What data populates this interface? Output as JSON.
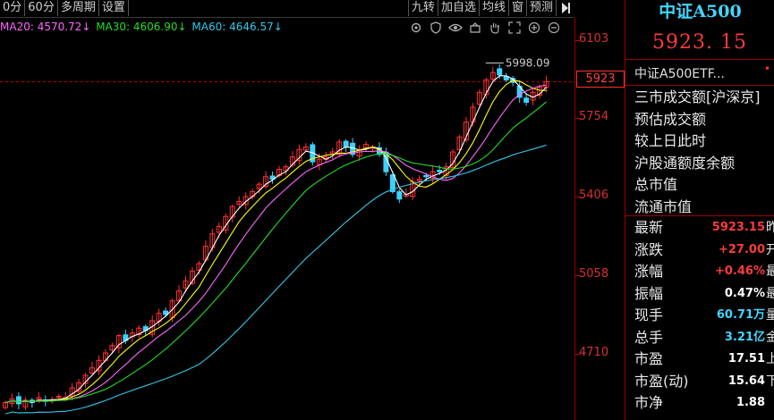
{
  "toolbar": {
    "left": [
      "0分",
      "60分",
      "多周期",
      "设置"
    ],
    "right": [
      "九转",
      "加自选",
      "均线",
      "窗",
      "预测"
    ]
  },
  "ma": {
    "ma20": "MA20: 4570.72↓",
    "ma30": "MA30: 4606.90↓",
    "ma60": "MA60: 4646.57↓",
    "colors": {
      "ma20": "#ff66ff",
      "ma30": "#22dd22",
      "ma60": "#33c8e8"
    }
  },
  "chart_icons": [
    "settings-icon",
    "shield-icon",
    "eye-icon",
    "basket-icon",
    "hand-icon",
    "expand-icon",
    "zoom-in-icon",
    "zoom-out-icon"
  ],
  "chart_data": {
    "type": "candlestick",
    "ylim": [
      4560,
      6180
    ],
    "y_ticks": [
      "6103",
      "5754",
      "5406",
      "5058",
      "4710"
    ],
    "current_price_label": "5923",
    "high_label": "5998.09",
    "series_colors": {
      "up": "#ff3232",
      "down": "#3cd2ff",
      "ma5": "#ffffff",
      "ma10": "#ffff00",
      "ma20": "#ff66ff",
      "ma30": "#22dd22",
      "ma60": "#33c8e8"
    },
    "closes": [
      4630,
      4645,
      4625,
      4640,
      4630,
      4650,
      4635,
      4640,
      4655,
      4650,
      4690,
      4710,
      4740,
      4770,
      4800,
      4830,
      4860,
      4900,
      4880,
      4910,
      4930,
      4920,
      4960,
      4990,
      4985,
      5040,
      5080,
      5120,
      5160,
      5190,
      5260,
      5310,
      5340,
      5380,
      5420,
      5440,
      5460,
      5480,
      5510,
      5540,
      5530,
      5570,
      5580,
      5620,
      5650,
      5660,
      5600,
      5610,
      5620,
      5640,
      5680,
      5660,
      5630,
      5650,
      5670,
      5660,
      5630,
      5560,
      5480,
      5450,
      5470,
      5520,
      5530,
      5540,
      5560,
      5560,
      5580,
      5640,
      5700,
      5760,
      5820,
      5880,
      5930,
      5960,
      5950,
      5930,
      5920,
      5860,
      5840,
      5880,
      5900,
      5923
    ]
  },
  "right": {
    "title": "中证A500",
    "price": "5923. 15",
    "etf": "中证A500ETF...",
    "etf_dot": "•",
    "lines": [
      "三市成交额[沪深京]",
      "预估成交额",
      "较上日此时",
      "沪股通额度余额",
      "总市值",
      "流通市值"
    ],
    "stats": [
      {
        "label": "最新",
        "value": "5923.15",
        "suffix": "昨",
        "color": "red"
      },
      {
        "label": "涨跌",
        "value": "+27.00",
        "suffix": "开",
        "color": "red"
      },
      {
        "label": "涨幅",
        "value": "+0.46%",
        "suffix": "最",
        "color": "red"
      },
      {
        "label": "振幅",
        "value": "0.47%",
        "suffix": "最",
        "color": "wh"
      },
      {
        "label": "现手",
        "value": "60.71万",
        "suffix": "量",
        "color": "cy"
      },
      {
        "label": "总手",
        "value": "3.21亿",
        "suffix": "金",
        "color": "cy"
      },
      {
        "label": "市盈",
        "value": "17.51",
        "suffix": "上",
        "color": "wh"
      },
      {
        "label": "市盈(动)",
        "value": "15.64",
        "suffix": "下",
        "color": "wh"
      },
      {
        "label": "市净",
        "value": "1.88",
        "suffix": "",
        "color": "wh"
      }
    ]
  }
}
